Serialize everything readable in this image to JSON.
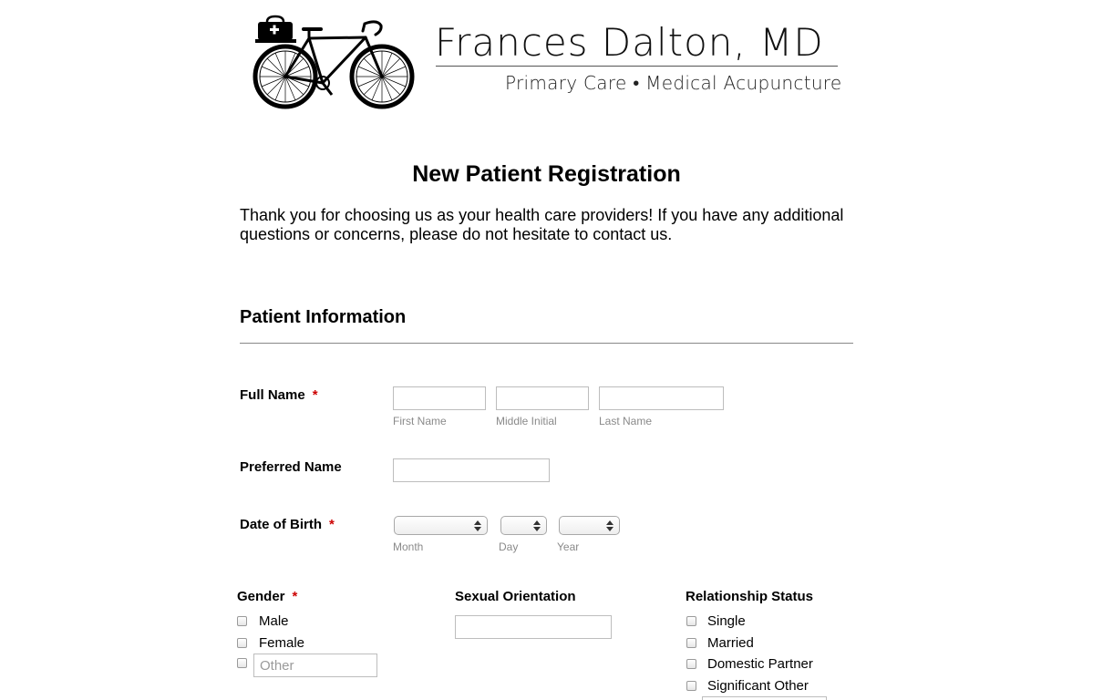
{
  "header": {
    "brand_name": "Frances Dalton, MD",
    "tagline": "Primary Care • Medical Acupuncture",
    "logo_icon": "bicycle-with-medical-bag-icon"
  },
  "form": {
    "title": "New Patient Registration",
    "intro": "Thank you for choosing us as your health care providers! If you have any additional questions or concerns, please do not hesitate to contact us."
  },
  "section": {
    "title": "Patient Information"
  },
  "required_marker": "*",
  "full_name": {
    "label": "Full Name",
    "first_sublabel": "First Name",
    "first_value": "",
    "middle_sublabel": "Middle Initial",
    "middle_value": "",
    "last_sublabel": "Last Name",
    "last_value": ""
  },
  "preferred_name": {
    "label": "Preferred Name",
    "value": ""
  },
  "dob": {
    "label": "Date of Birth",
    "month_sublabel": "Month",
    "day_sublabel": "Day",
    "year_sublabel": "Year",
    "month_value": "",
    "day_value": "",
    "year_value": ""
  },
  "gender": {
    "label": "Gender",
    "options": [
      "Male",
      "Female"
    ],
    "other_placeholder": "Other"
  },
  "sexual_orientation": {
    "label": "Sexual Orientation",
    "value": ""
  },
  "relationship_status": {
    "label": "Relationship Status",
    "options": [
      "Single",
      "Married",
      "Domestic Partner",
      "Significant Other"
    ]
  },
  "colors": {
    "required": "#cc0000",
    "sublabel": "#8a8a8a",
    "rule": "#888888"
  }
}
